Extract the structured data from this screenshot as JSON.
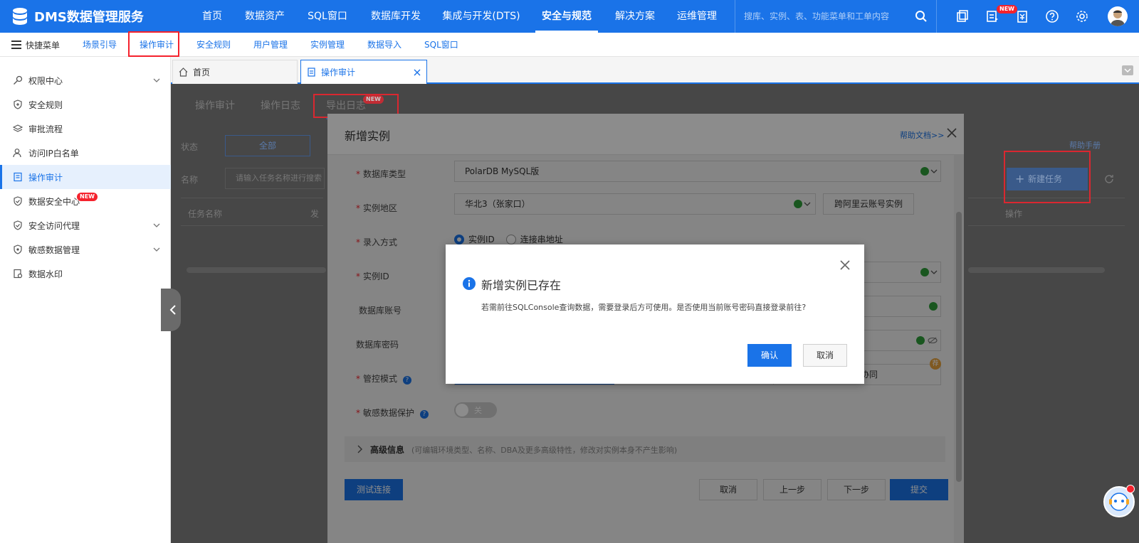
{
  "app": {
    "logo_text": "DMS数据管理服务"
  },
  "topnav": {
    "items": [
      "首页",
      "数据资产",
      "SQL窗口",
      "数据库开发",
      "集成与开发(DTS)",
      "安全与规范",
      "解决方案",
      "运维管理"
    ],
    "active": "安全与规范",
    "search_placeholder": "搜库、实例、表、功能菜单和工单内容",
    "new_badge": "NEW"
  },
  "subbar": {
    "menu_label": "快捷菜单",
    "items": [
      "场景引导",
      "操作审计",
      "安全规则",
      "用户管理",
      "实例管理",
      "数据导入",
      "SQL窗口"
    ]
  },
  "sidebar": {
    "items": [
      {
        "label": "权限中心",
        "expandable": true
      },
      {
        "label": "安全规则"
      },
      {
        "label": "审批流程"
      },
      {
        "label": "访问IP白名单"
      },
      {
        "label": "操作审计",
        "active": true
      },
      {
        "label": "数据安全中心",
        "badge": "NEW"
      },
      {
        "label": "安全访问代理",
        "expandable": true
      },
      {
        "label": "敏感数据管理",
        "expandable": true
      },
      {
        "label": "数据水印"
      }
    ]
  },
  "tabs": [
    {
      "label": "首页"
    },
    {
      "label": "操作审计",
      "active": true
    }
  ],
  "background": {
    "tabs": [
      "操作审计",
      "操作日志",
      "导出日志"
    ],
    "export_badge": "NEW",
    "status_label": "状态",
    "status_all": "全部",
    "name_label": "名称",
    "name_placeholder": "请输入任务名称进行搜索",
    "col_task": "任务名称",
    "col_start": "发",
    "col_op": "操作",
    "help_manual": "帮助手册",
    "new_task": "新建任务"
  },
  "modal": {
    "title": "新增实例",
    "help_link": "帮助文档>>",
    "fields": {
      "db_type": {
        "label": "数据库类型",
        "value": "PolarDB MySQL版"
      },
      "region": {
        "label": "实例地区",
        "value": "华北3（张家口）"
      },
      "cross_account": "跨阿里云账号实例",
      "entry": {
        "label": "录入方式",
        "opt1": "实例ID",
        "opt2": "连接串地址"
      },
      "instance_id": {
        "label": "实例ID"
      },
      "account": {
        "label": "数据库账号"
      },
      "password": {
        "label": "数据库密码"
      },
      "control_mode": {
        "label": "管控模式",
        "value_partial": "协同",
        "badge": "荐"
      },
      "sensitive": {
        "label": "敏感数据保护",
        "toggle": "关"
      }
    },
    "advanced": {
      "title": "高级信息",
      "desc": "(可编辑环境类型、名称、DBA及更多高级特性，修改对实例本身不产生影响)"
    },
    "buttons": {
      "test": "测试连接",
      "cancel": "取消",
      "prev": "上一步",
      "next": "下一步",
      "submit": "提交"
    }
  },
  "dialog": {
    "title": "新增实例已存在",
    "message": "若需前往SQLConsole查询数据，需要登录后方可使用。是否使用当前账号密码直接登录前往?",
    "confirm": "确认",
    "cancel": "取消"
  },
  "colors": {
    "brand": "#1a73e8",
    "danger": "#f5222d",
    "success": "#2e9d3a",
    "overlay": "#474747"
  }
}
